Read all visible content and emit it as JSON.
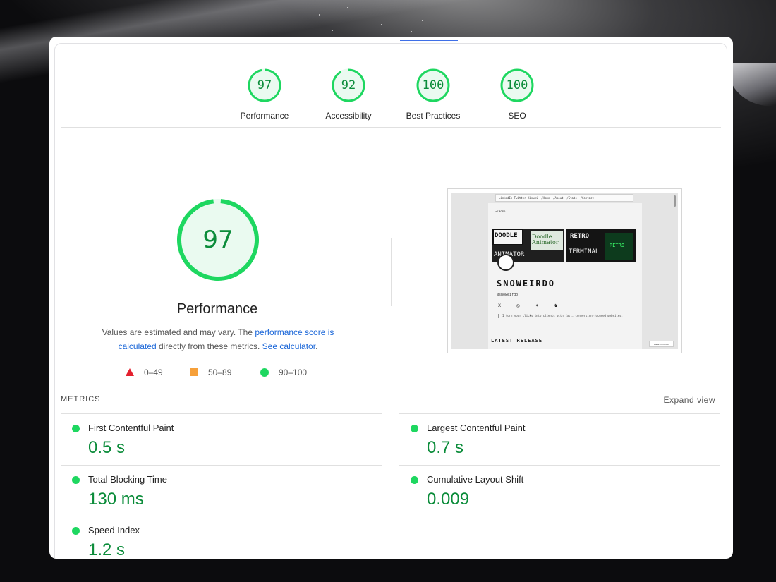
{
  "colors": {
    "pass": "#0b8c3a",
    "pass_dot": "#1ed760",
    "fail": "#e4202e",
    "average": "#f6a03a",
    "link": "#1a66d8"
  },
  "categories": [
    {
      "score": "97",
      "label": "Performance"
    },
    {
      "score": "92",
      "label": "Accessibility"
    },
    {
      "score": "100",
      "label": "Best Practices"
    },
    {
      "score": "100",
      "label": "SEO"
    }
  ],
  "performance": {
    "score": "97",
    "title": "Performance",
    "desc_1": "Values are estimated and may vary. The ",
    "desc_link_1": "performance score is calculated",
    "desc_2": " directly from these metrics. ",
    "desc_link_2": "See calculator",
    "desc_3": "."
  },
  "legend": [
    {
      "range": "0–49",
      "icon": "triangle-icon"
    },
    {
      "range": "50–89",
      "icon": "square-icon"
    },
    {
      "range": "90–100",
      "icon": "circle-icon"
    }
  ],
  "thumbnail": {
    "nav_text": "LinkedIn Twitter Kisumi      ~/Home ~/About ~/Stats ~/Contact",
    "home_text": "~/Home",
    "card1_top": "DOODLE",
    "card1_script": "Doodle Animator",
    "card1_bottom": "ANIMATOR",
    "card2_top": "RETRO",
    "card2_bottom": "TERMINAL",
    "card2_green": "RETRO",
    "name": "SNOWEIRDO",
    "handle": "@snoweirdo",
    "icons": "X ◎ ✦ ♞",
    "bio": "I turn your clicks into clients with fast, conversion-focused websites.",
    "latest": "LATEST RELEASE",
    "badge": "Made in Framer"
  },
  "metrics": {
    "heading": "METRICS",
    "expand_label": "Expand view",
    "items": [
      {
        "title": "First Contentful Paint",
        "value": "0.5 s"
      },
      {
        "title": "Largest Contentful Paint",
        "value": "0.7 s"
      },
      {
        "title": "Total Blocking Time",
        "value": "130 ms"
      },
      {
        "title": "Cumulative Layout Shift",
        "value": "0.009"
      },
      {
        "title": "Speed Index",
        "value": "1.2 s"
      }
    ]
  }
}
